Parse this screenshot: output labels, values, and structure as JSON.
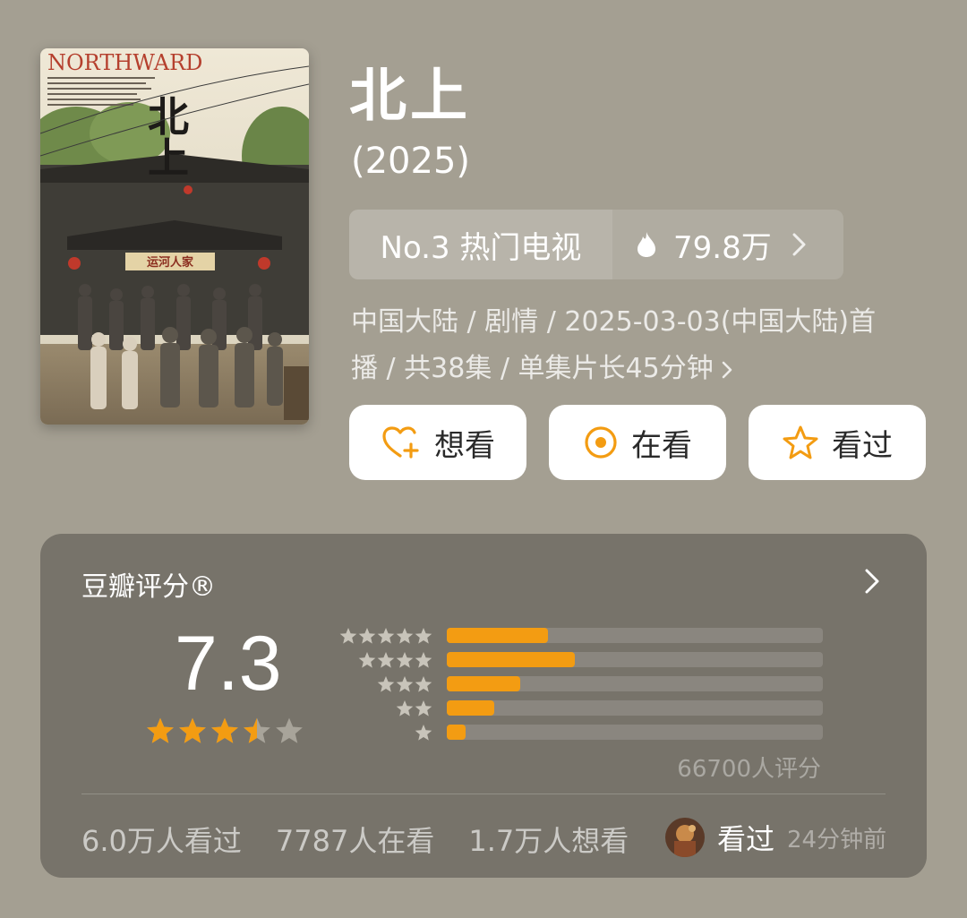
{
  "movie": {
    "title": "北上",
    "year": "(2025)",
    "poster": {
      "wordmark": "NORTHWARD",
      "title_calligraphy": "北上",
      "sign_text": "运河人家"
    }
  },
  "rank": {
    "label": "No.3 热门电视",
    "heat": "79.8万",
    "icon": "flame-icon"
  },
  "meta": {
    "line1": "中国大陆 / 剧情 / 2025-03-03(中国大陆)首",
    "line2": "播 / 共38集 / 单集片长45分钟"
  },
  "actions": {
    "want": "想看",
    "doing": "在看",
    "done": "看过"
  },
  "rating": {
    "title": "豆瓣评分®",
    "score": "7.3",
    "stars": 3.5,
    "distribution": [
      {
        "stars": 5,
        "fraction": 0.27
      },
      {
        "stars": 4,
        "fraction": 0.34
      },
      {
        "stars": 3,
        "fraction": 0.195
      },
      {
        "stars": 2,
        "fraction": 0.125
      },
      {
        "stars": 1,
        "fraction": 0.05
      }
    ],
    "count": "66700人评分"
  },
  "stats": {
    "watched": "6.0万人看过",
    "watching": "7787人在看",
    "want": "1.7万人想看"
  },
  "friend": {
    "status": "看过",
    "time": "24分钟前"
  },
  "colors": {
    "accent": "#f39c12",
    "background": "#a49f92",
    "card": "#77736a"
  }
}
